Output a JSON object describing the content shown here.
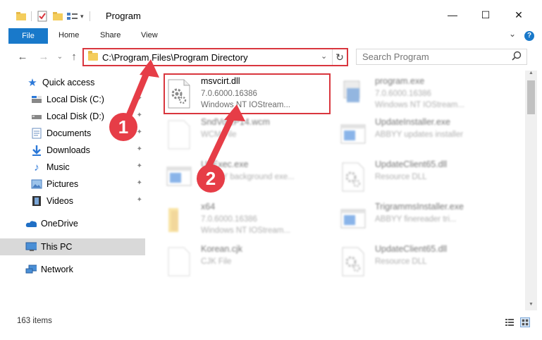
{
  "window": {
    "title": "Program",
    "minimize_glyph": "—",
    "maximize_glyph": "☐",
    "close_glyph": "✕"
  },
  "ribbon": {
    "file": "File",
    "tabs": [
      "Home",
      "Share",
      "View"
    ],
    "expand_glyph": "⌄",
    "help_glyph": "?"
  },
  "nav": {
    "back_glyph": "←",
    "forward_glyph": "→",
    "recent_glyph": "⌄",
    "up_glyph": "↑"
  },
  "address": {
    "path": "C:\\Program Files\\Program Directory",
    "chevron": "⌄",
    "refresh_glyph": "↻"
  },
  "search": {
    "placeholder": "Search Program",
    "icon_glyph": "⚲"
  },
  "sidebar": {
    "items": [
      {
        "label": "Quick access",
        "icon": "star-icon"
      },
      {
        "label": "Local Disk (C:)",
        "icon": "drive-icon"
      },
      {
        "label": "Local Disk (D:)",
        "icon": "drive-icon"
      },
      {
        "label": "Documents",
        "icon": "documents-icon"
      },
      {
        "label": "Downloads",
        "icon": "download-icon"
      },
      {
        "label": "Music",
        "icon": "music-icon"
      },
      {
        "label": "Pictures",
        "icon": "pictures-icon"
      },
      {
        "label": "Videos",
        "icon": "videos-icon"
      },
      {
        "label": "OneDrive",
        "icon": "cloud-icon"
      },
      {
        "label": "This PC",
        "icon": "computer-icon"
      },
      {
        "label": "Network",
        "icon": "network-icon"
      }
    ],
    "pin_glyph": "📌"
  },
  "files": {
    "left": [
      {
        "name": "msvcirt.dll",
        "meta": "7.0.6000.16386",
        "meta2": "Windows NT IOStream...",
        "icon": "dll-gear-icon"
      },
      {
        "name": "SndVol2P14.wcm",
        "meta": "WCM File",
        "meta2": "",
        "icon": "blank-file-icon"
      },
      {
        "name": "UnExec.exe",
        "meta": "ABBYY background exe...",
        "meta2": "",
        "icon": "exe-icon"
      },
      {
        "name": "x64",
        "meta": "7.0.6000.16386",
        "meta2": "Windows NT IOStream...",
        "icon": "folder-file-icon"
      },
      {
        "name": "Korean.cjk",
        "meta": "CJK File",
        "meta2": "",
        "icon": "blank-file-icon"
      }
    ],
    "right": [
      {
        "name": "program.exe",
        "meta": "7.0.6000.16386",
        "meta2": "Windows NT IOStream...",
        "icon": "program-exe-icon"
      },
      {
        "name": "UpdateInstaller.exe",
        "meta": "ABBYY updates installer",
        "meta2": "",
        "icon": "exe-icon"
      },
      {
        "name": "UpdateClient65.dll",
        "meta": "Resource DLL",
        "meta2": "",
        "icon": "dll-gear-icon"
      },
      {
        "name": "TrigrammsInstaller.exe",
        "meta": "ABBYY finereader tri...",
        "meta2": "",
        "icon": "exe-icon"
      },
      {
        "name": "UpdateClient65.dll",
        "meta": "Resource DLL",
        "meta2": "",
        "icon": "dll-gear-icon"
      }
    ]
  },
  "annotations": {
    "step1": "1",
    "step2": "2",
    "accent": "#e63d47"
  },
  "status": {
    "count": "163 items"
  }
}
